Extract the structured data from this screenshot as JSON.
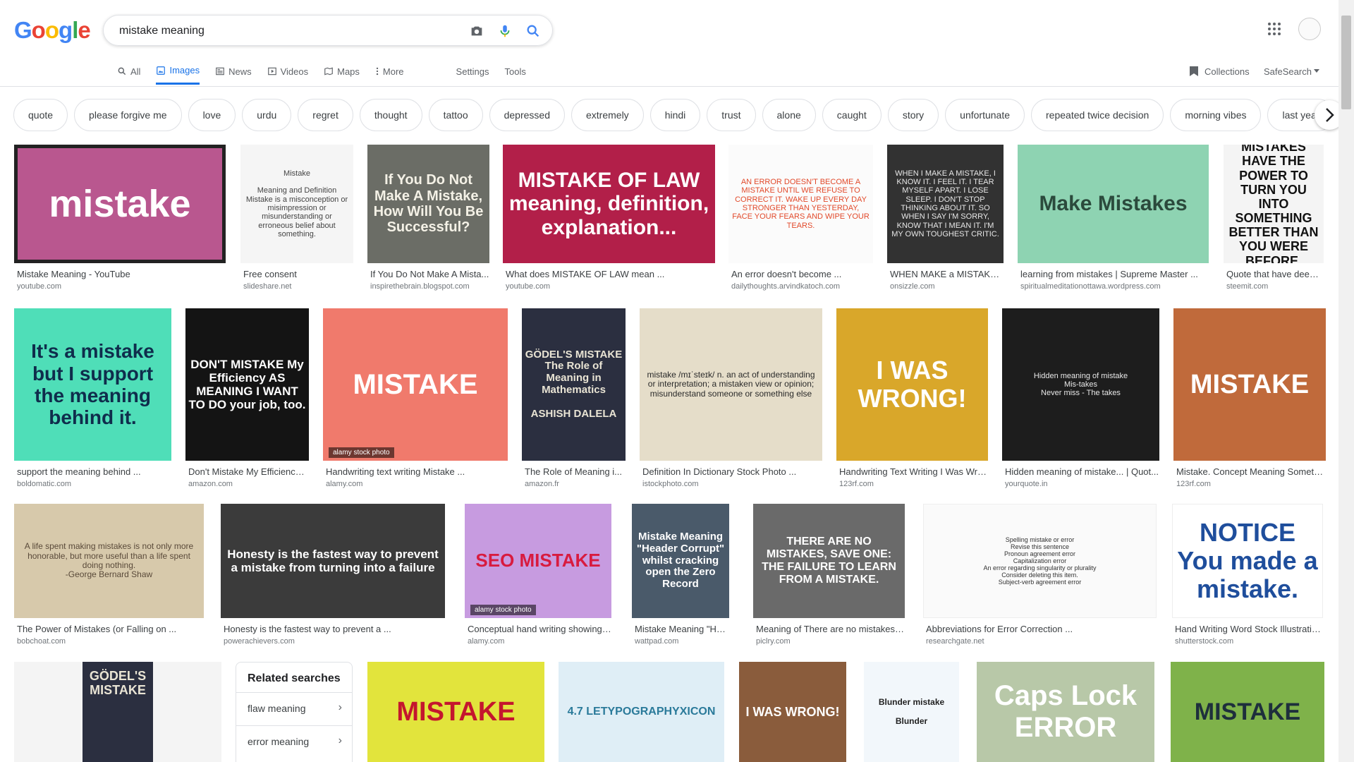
{
  "logo": {
    "letters": [
      "G",
      "o",
      "o",
      "g",
      "l",
      "e"
    ],
    "colors": [
      "#4285F4",
      "#EA4335",
      "#FBBC05",
      "#4285F4",
      "#34A853",
      "#EA4335"
    ]
  },
  "search": {
    "query": "mistake meaning"
  },
  "tabs": [
    {
      "label": "All",
      "icon": "search-icon"
    },
    {
      "label": "Images",
      "icon": "image-icon"
    },
    {
      "label": "News",
      "icon": "news-icon"
    },
    {
      "label": "Videos",
      "icon": "video-icon"
    },
    {
      "label": "Maps",
      "icon": "map-icon"
    },
    {
      "label": "More",
      "icon": "more-vert-icon"
    }
  ],
  "tools": {
    "settings": "Settings",
    "tools": "Tools",
    "collections": "Collections",
    "safesearch": "SafeSearch"
  },
  "chips": [
    "quote",
    "please forgive me",
    "love",
    "urdu",
    "regret",
    "thought",
    "tattoo",
    "depressed",
    "extremely",
    "hindi",
    "trust",
    "alone",
    "caught",
    "story",
    "unfortunate",
    "repeated twice decision",
    "morning vibes",
    "last year"
  ],
  "results": [
    {
      "title": "Mistake Meaning - YouTube",
      "source": "youtube.com",
      "text": "mistake",
      "bg": "#b9578f",
      "fg": "#ffffff"
    },
    {
      "title": "Free consent",
      "source": "slideshare.net",
      "text": "Mistake\n\nMeaning and Definition\nMistake is a misconception or misimpression or misunderstanding or erroneous belief about something.",
      "bg": "#f5f5f5",
      "fg": "#444444"
    },
    {
      "title": "If You Do Not Make A Mista...",
      "source": "inspirethebrain.blogspot.com",
      "text": "If You Do Not Make A Mistake, How Will You Be Successful?",
      "bg": "#6b6d66",
      "fg": "#f4f1e6"
    },
    {
      "title": "What does MISTAKE OF LAW mean ...",
      "source": "youtube.com",
      "text": "MISTAKE OF LAW\nmeaning, definition, explanation...",
      "bg": "#b21f49",
      "fg": "#ffffff"
    },
    {
      "title": "An error doesn't become ...",
      "source": "dailythoughts.arvindkatoch.com",
      "text": "AN ERROR DOESN'T BECOME A MISTAKE UNTIL WE REFUSE TO CORRECT IT. WAKE UP EVERY DAY STRONGER THAN YESTERDAY, FACE YOUR FEARS AND WIPE YOUR TEARS.",
      "bg": "#fbfbfb",
      "fg": "#e24a2b"
    },
    {
      "title": "WHEN MAKE a MISTAKE...",
      "source": "onsizzle.com",
      "text": "WHEN I MAKE A MISTAKE, I KNOW IT. I FEEL IT. I TEAR MYSELF APART. I LOSE SLEEP. I DON'T STOP THINKING ABOUT IT. SO WHEN I SAY I'M SORRY, KNOW THAT I MEAN IT. I'M MY OWN TOUGHEST CRITIC.",
      "bg": "#323232",
      "fg": "#e8e8e8"
    },
    {
      "title": "learning from mistakes | Supreme Master ...",
      "source": "spiritualmeditationottawa.wordpress.com",
      "text": "Make Mistakes",
      "bg": "#8ed3b2",
      "fg": "#2b4a3c"
    },
    {
      "title": "Quote that have deep ...",
      "source": "steemit.com",
      "text": "MISTAKES HAVE THE POWER TO TURN YOU INTO SOMETHING BETTER THAN YOU WERE BEFORE.",
      "bg": "#f4f4f4",
      "fg": "#111111"
    },
    {
      "title": "support the meaning behind ...",
      "source": "boldomatic.com",
      "text": "It's a mistake but I support the meaning behind it.",
      "bg": "#4fdeb8",
      "fg": "#0f2d4c"
    },
    {
      "title": "Don't Mistake My Efficiency ...",
      "source": "amazon.com",
      "text": "DON'T MISTAKE My Efficiency AS MEANING I WANT TO DO your job, too.",
      "bg": "#141414",
      "fg": "#ffffff"
    },
    {
      "title": "Handwriting text writing Mistake ...",
      "source": "alamy.com",
      "text": "MISTAKE",
      "bg": "#f07a6c",
      "fg": "#ffffff",
      "watermark": "alamy stock photo"
    },
    {
      "title": "The Role of Meaning i...",
      "source": "amazon.fr",
      "text": "GÖDEL'S MISTAKE\nThe Role of Meaning in Mathematics\n\nASHISH DALELA",
      "bg": "#2b2f40",
      "fg": "#e9e4d4"
    },
    {
      "title": "Definition In Dictionary Stock Photo ...",
      "source": "istockphoto.com",
      "text": "mistake /mɪˈsteɪk/ n. an act of understanding or interpretation; a mistaken view or opinion; misunderstand someone or something else",
      "bg": "#e5ddc9",
      "fg": "#2a2a2a"
    },
    {
      "title": "Handwriting Text Writing I Was Wro...",
      "source": "123rf.com",
      "text": "I WAS WRONG!",
      "bg": "#d9a72a",
      "fg": "#ffffff"
    },
    {
      "title": "Hidden meaning of mistake... | Quot...",
      "source": "yourquote.in",
      "text": "Hidden meaning of mistake\nMis-takes\nNever miss - The takes",
      "bg": "#1d1d1d",
      "fg": "#e8e8e8"
    },
    {
      "title": "Mistake. Concept Meaning Someth...",
      "source": "123rf.com",
      "text": "MISTAKE",
      "bg": "#c06a3b",
      "fg": "#ffffff"
    },
    {
      "title": "The Power of Mistakes (or Falling on ...",
      "source": "bobchoat.com",
      "text": "A life spent making mistakes is not only more honorable, but more useful than a life spent doing nothing.\n-George Bernard Shaw",
      "bg": "#d7c9ab",
      "fg": "#5a4a3a"
    },
    {
      "title": "Honesty is the fastest way to prevent a ...",
      "source": "powerachievers.com",
      "text": "Honesty is the fastest way to prevent a mistake from turning into a failure",
      "bg": "#3b3b3b",
      "fg": "#ffffff"
    },
    {
      "title": "Conceptual hand writing showing S...",
      "source": "alamy.com",
      "text": "SEO MISTAKE",
      "bg": "#c79be0",
      "fg": "#d81b3f",
      "watermark": "alamy stock photo"
    },
    {
      "title": "Mistake Meaning \"Head...",
      "source": "wattpad.com",
      "text": "Mistake Meaning \"Header Corrupt\" whilst cracking open the Zero Record",
      "bg": "#4a5a6a",
      "fg": "#ffffff"
    },
    {
      "title": "Meaning of There are no mistakes, s...",
      "source": "piclry.com",
      "text": "THERE ARE NO MISTAKES, SAVE ONE: THE FAILURE TO LEARN FROM A MISTAKE.",
      "bg": "#6a6a6a",
      "fg": "#ffffff"
    },
    {
      "title": "Abbreviations for Error Correction ...",
      "source": "researchgate.net",
      "text": "Spelling mistake or error\nRevise this sentence\nPronoun agreement error\nCapitalization error\nAn error regarding singularity or plurality\nConsider deleting this item.\nSubject-verb agreement error",
      "bg": "#fafafa",
      "fg": "#333333"
    },
    {
      "title": "Hand Writing Word Stock Illustratio...",
      "source": "shutterstock.com",
      "text": "NOTICE\nYou made a mistake.",
      "bg": "#ffffff",
      "fg": "#1f4e9c"
    }
  ],
  "bottom_row": [
    {
      "text": "GÖDEL'S MISTAKE",
      "bg": "#2b2f40",
      "fg": "#e9e4d4"
    },
    {
      "text": "MISTAKE",
      "bg": "#e2e43c",
      "fg": "#c4162e"
    },
    {
      "text": "4.7 LETYPOGRAPHYXICON",
      "bg": "#dfeef6",
      "fg": "#2a7a9a"
    },
    {
      "text": "I WAS WRONG!",
      "bg": "#8a5c3c",
      "fg": "#ffffff"
    },
    {
      "text": "Blunder mistake\n\nBlunder",
      "bg": "#f2f7fb",
      "fg": "#222222"
    },
    {
      "text": "Caps Lock\nERROR",
      "bg": "#b8c8a8",
      "fg": "#ffffff"
    },
    {
      "text": "MISTAKE",
      "bg": "#7fb24a",
      "fg": "#1e2f3c"
    }
  ],
  "related": {
    "title": "Related searches",
    "items": [
      "flaw meaning",
      "error meaning"
    ]
  }
}
